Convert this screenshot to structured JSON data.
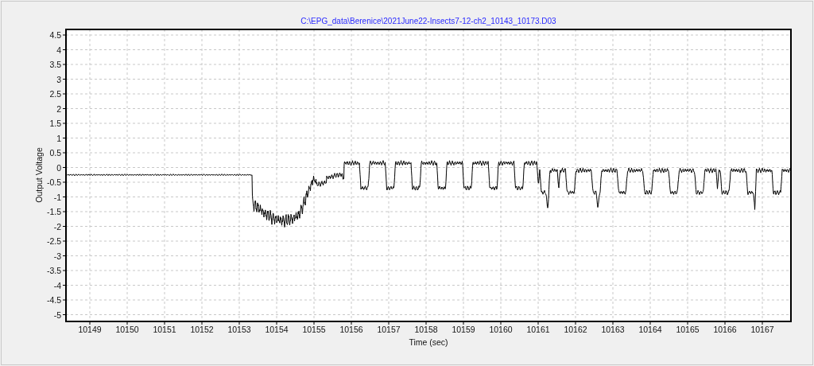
{
  "plot": {
    "title": "C:\\EPG_data\\Berenice\\2021June22-Insects7-12-ch2_10143_10173.D03",
    "ylabel": "Output Voltage",
    "xlabel": "Time (sec)",
    "yticks": [
      "4.5",
      "4",
      "3.5",
      "3",
      "2.5",
      "2",
      "1.5",
      "1",
      "0.5",
      "0",
      "-0.5",
      "-1",
      "-1.5",
      "-2",
      "-2.5",
      "-3",
      "-3.5",
      "-4",
      "-4.5",
      "-5"
    ],
    "xticks": [
      "10149",
      "10150",
      "10151",
      "10152",
      "10153",
      "10154",
      "10155",
      "10156",
      "10157",
      "10158",
      "10159",
      "10160",
      "10161",
      "10162",
      "10163",
      "10164",
      "10165",
      "10166",
      "10167"
    ]
  }
}
